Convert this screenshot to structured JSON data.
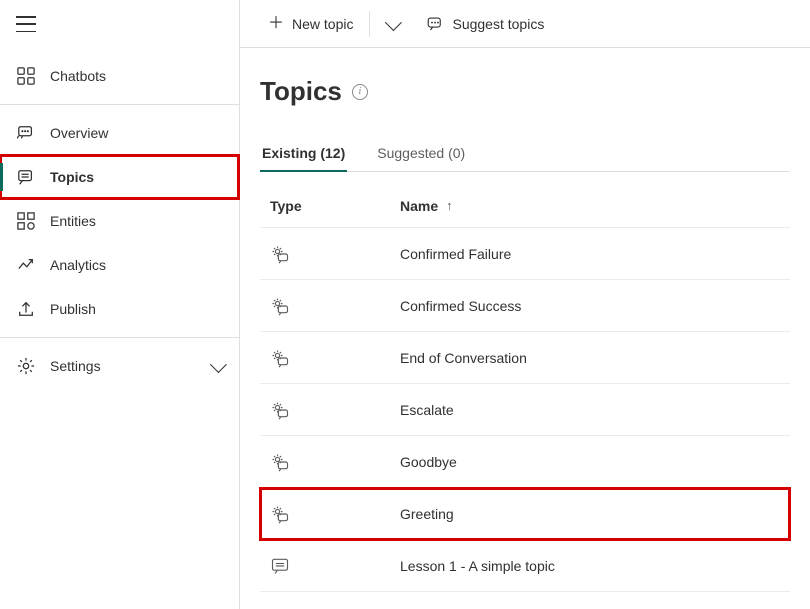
{
  "sidebar": {
    "groups": [
      {
        "items": [
          {
            "icon": "chatbots",
            "label": "Chatbots",
            "active": false
          }
        ]
      },
      {
        "items": [
          {
            "icon": "overview",
            "label": "Overview",
            "active": false
          },
          {
            "icon": "topics",
            "label": "Topics",
            "active": true,
            "highlighted": true
          },
          {
            "icon": "entities",
            "label": "Entities",
            "active": false
          },
          {
            "icon": "analytics",
            "label": "Analytics",
            "active": false
          },
          {
            "icon": "publish",
            "label": "Publish",
            "active": false
          }
        ]
      },
      {
        "last": true,
        "items": [
          {
            "icon": "settings",
            "label": "Settings",
            "active": false,
            "expandable": true
          }
        ]
      }
    ]
  },
  "commandbar": {
    "new_topic": "New topic",
    "suggest_topics": "Suggest topics"
  },
  "page": {
    "title": "Topics"
  },
  "tabs": [
    {
      "label": "Existing (12)",
      "active": true
    },
    {
      "label": "Suggested (0)",
      "active": false
    }
  ],
  "table": {
    "columns": {
      "type": "Type",
      "name": "Name"
    },
    "sort": {
      "column": "name",
      "direction": "asc"
    },
    "rows": [
      {
        "type_icon": "system",
        "name": "Confirmed Failure",
        "highlighted": false
      },
      {
        "type_icon": "system",
        "name": "Confirmed Success",
        "highlighted": false
      },
      {
        "type_icon": "system",
        "name": "End of Conversation",
        "highlighted": false
      },
      {
        "type_icon": "system",
        "name": "Escalate",
        "highlighted": false
      },
      {
        "type_icon": "system",
        "name": "Goodbye",
        "highlighted": false
      },
      {
        "type_icon": "system",
        "name": "Greeting",
        "highlighted": true
      },
      {
        "type_icon": "user",
        "name": "Lesson 1 - A simple topic",
        "highlighted": false
      }
    ]
  }
}
